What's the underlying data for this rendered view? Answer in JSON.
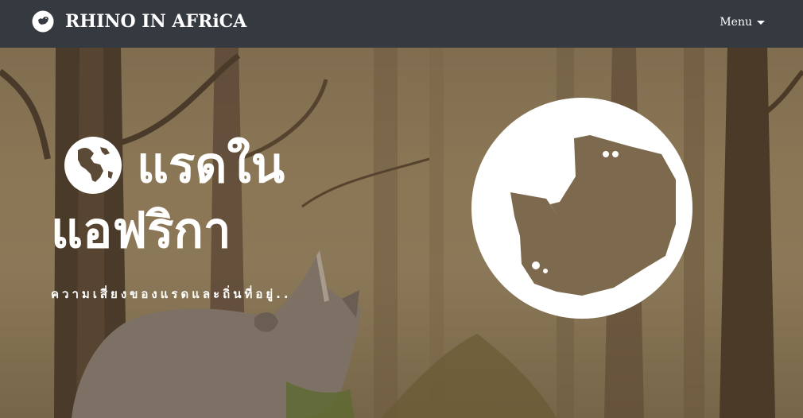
{
  "navbar": {
    "brand_text": "RHINO IN AFRiCA",
    "brand_icon": "rhino-logo-icon",
    "menu_label": "Menu",
    "menu_icon": "caret-down-icon",
    "background": "#343a40"
  },
  "hero": {
    "title_line1": "แรดใน",
    "title_line2": "แอฟริกา",
    "title_icon": "globe-americas-icon",
    "subtitle": "ความเสี่ยงของแรดและถิ่นที่อยู่..",
    "logo_icon": "rhino-head-logo",
    "background_image": "rhino-in-forest-photo"
  }
}
